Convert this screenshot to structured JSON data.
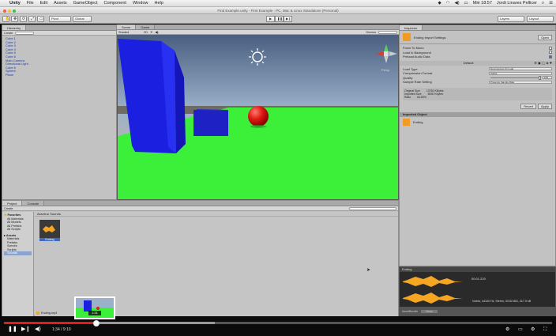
{
  "menubar": {
    "apple": "",
    "app": "Unity",
    "items": [
      "File",
      "Edit",
      "Assets",
      "GameObject",
      "Component",
      "Window",
      "Help"
    ],
    "clock": "Mié 18:57",
    "user": "Jordi Linares Pellicer"
  },
  "titlebar": {
    "title": "Find Example.unity - First Example - PC, Mac & Linux Standalone (Personal)"
  },
  "toolbar": {
    "tools": [
      "✋",
      "✥",
      "⟳",
      "⤢",
      "▭"
    ],
    "pivot": "Pivot",
    "global": "Global",
    "play": "▶",
    "pause": "❚❚",
    "step": "▶❙",
    "layers": "Layers",
    "layout": "Layout"
  },
  "hierarchy": {
    "tab": "Hierarchy",
    "create": "Create",
    "items": [
      "Cube 1",
      "Cube 2",
      "Cube 3",
      "Cube 4",
      "Cube 5",
      "Cube 6",
      "Main Camera",
      "Directional Light",
      "Cube 6",
      "Sphere",
      "Plane"
    ]
  },
  "scene": {
    "tabs": [
      "Scene",
      "Game"
    ],
    "shading": "Shaded",
    "mode": "2D",
    "gizmos": "Gizmos",
    "all": "All",
    "persp": "Persp"
  },
  "inspector": {
    "tab": "Inspector",
    "title": "Ending Import Settings",
    "open": "Open",
    "rows": [
      {
        "label": "Force To Mono",
        "checked": false
      },
      {
        "label": "Load In Background",
        "checked": false
      },
      {
        "label": "Preload Audio Data",
        "checked": true
      }
    ],
    "default_tab": "Default",
    "fields": [
      {
        "label": "Load Type",
        "value": "Decompress On Load"
      },
      {
        "label": "Compression Format",
        "value": "Vorbis"
      },
      {
        "label": "Quality",
        "value": "100"
      },
      {
        "label": "Sample Rate Setting",
        "value": "Preserve Sample Rate"
      }
    ],
    "sizes": [
      {
        "label": "Original Size",
        "value": "13782 KBytes"
      },
      {
        "label": "Imported Size",
        "value": "8930 Kbytes"
      },
      {
        "label": "Ratio",
        "value": "64.80%"
      }
    ],
    "revert": "Revert",
    "apply": "Apply",
    "imported_object": "Imported Object",
    "asset_name": "Ending"
  },
  "preview": {
    "title": "Ending",
    "time": "00:01.220",
    "info": "Vorbis, 44100 Hz, Stereo, 00:52.861, 317.9 kB",
    "bundle": "AssetBundle",
    "none": "None"
  },
  "project": {
    "tabs": [
      "Project",
      "Console"
    ],
    "create": "Create",
    "breadcrumb": [
      "Assets",
      "Sounds"
    ],
    "favorites": "Favorites",
    "favorite_items": [
      "All Materials",
      "All Models",
      "All Prefabs",
      "All Scripts"
    ],
    "assets": "Assets",
    "asset_folders": [
      "Materials",
      "Prefabs",
      "Scenes",
      "Scripts",
      "Sounds"
    ],
    "file_label": "Ending",
    "status_file": "Ending.mp3"
  },
  "player": {
    "current_time": "1:34",
    "total_time": "9:19",
    "thumb_time": "1:31",
    "progress": 0.168,
    "buffered": 0.385
  }
}
